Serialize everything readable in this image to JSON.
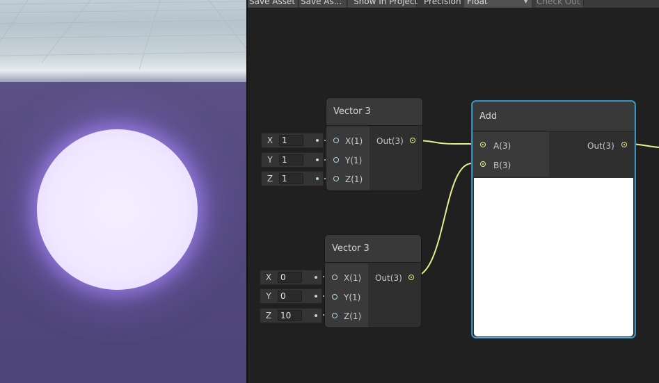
{
  "toolbar": {
    "save_asset": "Save Asset",
    "save_as": "Save As...",
    "show_in_project": "Show In Project",
    "precision_label": "Precision",
    "precision_value": "Float",
    "check_out": "Check Out"
  },
  "nodes": {
    "vector3_a": {
      "title": "Vector 3",
      "fields": [
        {
          "letter": "X",
          "value": "1"
        },
        {
          "letter": "Y",
          "value": "1"
        },
        {
          "letter": "Z",
          "value": "1"
        }
      ],
      "ports_in": [
        "X(1)",
        "Y(1)",
        "Z(1)"
      ],
      "port_out": "Out(3)"
    },
    "vector3_b": {
      "title": "Vector 3",
      "fields": [
        {
          "letter": "X",
          "value": "0"
        },
        {
          "letter": "Y",
          "value": "0"
        },
        {
          "letter": "Z",
          "value": "10"
        }
      ],
      "ports_in": [
        "X(1)",
        "Y(1)",
        "Z(1)"
      ],
      "port_out": "Out(3)"
    },
    "add": {
      "title": "Add",
      "ports_in": [
        "A(3)",
        "B(3)"
      ],
      "port_out": "Out(3)"
    }
  },
  "colors": {
    "wire": "#e9ee8d",
    "input_port": "#b7d8e3",
    "selection": "#4bb0e4"
  }
}
